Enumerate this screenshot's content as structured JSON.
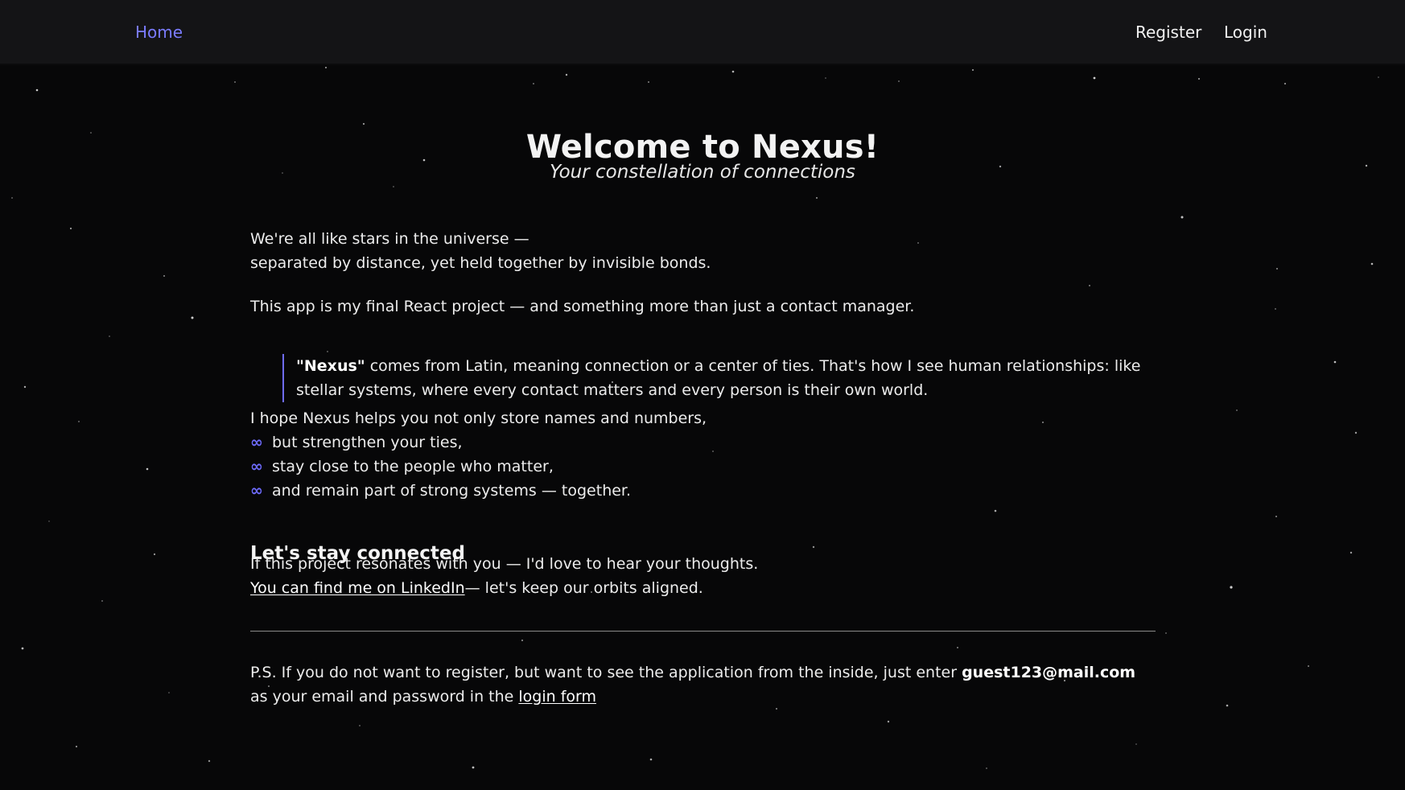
{
  "nav": {
    "home": "Home",
    "register": "Register",
    "login": "Login"
  },
  "hero": {
    "title": "Welcome to Nexus!",
    "subtitle": "Your constellation of connections"
  },
  "intro": {
    "line1": "We're all like stars in the universe —",
    "line2": "separated by distance, yet held together by invisible bonds.",
    "paragraph2": "This app is my final React project — and something more than just a contact manager."
  },
  "quote": {
    "term": "\"Nexus\"",
    "line1_rest": " comes from Latin, meaning connection or a center of ties. That's how I see human relationships: like",
    "line2": "stellar systems, where every contact matters and every person is their own world."
  },
  "hopes": {
    "lead": "I hope Nexus helps you not only store names and numbers,",
    "items": [
      "but strengthen your ties,",
      "stay close to the people who matter,",
      "and remain part of strong systems — together."
    ]
  },
  "connect": {
    "title": "Let's stay connected",
    "line1": "If this project resonates with you — I'd love to hear your thoughts.",
    "linkedin_link": "You can find me on LinkedIn",
    "linkedin_rest": "— let's keep our orbits aligned."
  },
  "ps": {
    "prefix": "P.S. If you do not want to register, but want to see the application from the inside, just enter ",
    "email": "guest123@mail.com",
    "line2_prefix": "as your email and password in the ",
    "login_link": "login form"
  },
  "colors": {
    "accent": "#6f6cff",
    "background": "#070708",
    "header": "#141416"
  },
  "icons": {
    "list_marker": "infinity-icon"
  }
}
